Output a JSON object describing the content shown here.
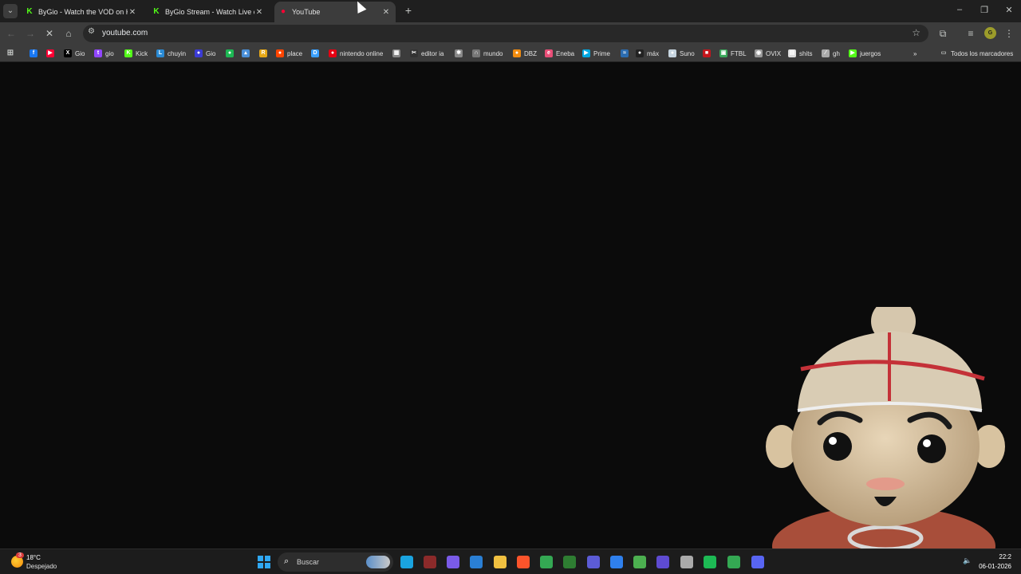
{
  "tabs": [
    {
      "title": "ByGio - Watch the VOD on Kick",
      "icon": "kick-icon",
      "color": "#53fc18"
    },
    {
      "title": "ByGio Stream - Watch Live on Kick",
      "icon": "kick-icon",
      "color": "#53fc18"
    },
    {
      "title": "YouTube",
      "icon": "youtube-icon",
      "color": "#ff0033"
    }
  ],
  "address": {
    "url": "youtube.com"
  },
  "bookmarks": [
    {
      "label": "",
      "icon": "facebook-icon",
      "color": "#1877f2"
    },
    {
      "label": "",
      "icon": "youtube-icon",
      "color": "#ff0033"
    },
    {
      "label": "Gio",
      "icon": "x-icon",
      "color": "#000000"
    },
    {
      "label": "gio",
      "icon": "twitch-icon",
      "color": "#9146ff"
    },
    {
      "label": "Kick",
      "icon": "kick-icon",
      "color": "#53fc18"
    },
    {
      "label": "chuyin",
      "icon": "letter-l-icon",
      "color": "#2a8ad4"
    },
    {
      "label": "Gio",
      "icon": "avatar-icon",
      "color": "#3b3bd4"
    },
    {
      "label": "",
      "icon": "green-circle-icon",
      "color": "#1db954"
    },
    {
      "label": "",
      "icon": "chart-icon",
      "color": "#4a90d9"
    },
    {
      "label": "",
      "icon": "r-icon",
      "color": "#e6a817"
    },
    {
      "label": "place",
      "icon": "reddit-icon",
      "color": "#ff4500"
    },
    {
      "label": "",
      "icon": "d-icon",
      "color": "#3aa0ff"
    },
    {
      "label": "nintendo online",
      "icon": "nintendo-icon",
      "color": "#e60012"
    },
    {
      "label": "",
      "icon": "grid-icon",
      "color": "#888888"
    },
    {
      "label": "editor ia",
      "icon": "capcut-icon",
      "color": "#333333"
    },
    {
      "label": "",
      "icon": "openai-icon",
      "color": "#888888"
    },
    {
      "label": "mundo",
      "icon": "headphones-icon",
      "color": "#777777"
    },
    {
      "label": "DBZ",
      "icon": "dragonball-icon",
      "color": "#f28c0f"
    },
    {
      "label": "Eneba",
      "icon": "eneba-icon",
      "color": "#e94e77"
    },
    {
      "label": "Prime",
      "icon": "prime-icon",
      "color": "#00a8e1"
    },
    {
      "label": "",
      "icon": "wave-icon",
      "color": "#2b6cb0"
    },
    {
      "label": "máx",
      "icon": "max-icon",
      "color": "#222222"
    },
    {
      "label": "Suno",
      "icon": "steam-icon",
      "color": "#c7d5e0"
    },
    {
      "label": "",
      "icon": "red-box-icon",
      "color": "#c4161c"
    },
    {
      "label": "FTBL",
      "icon": "ftbl-icon",
      "color": "#3aa65a"
    },
    {
      "label": "OVIX",
      "icon": "ovix-icon",
      "color": "#999999"
    },
    {
      "label": "shits",
      "icon": "shits-icon",
      "color": "#dddddd"
    },
    {
      "label": "gh",
      "icon": "wand-icon",
      "color": "#aaaaaa"
    },
    {
      "label": "juergos",
      "icon": "juergos-icon",
      "color": "#53fc18"
    }
  ],
  "bookmarks_folder": "Todos los marcadores",
  "weather": {
    "temp": "18°C",
    "desc": "Despejado",
    "badge": "3"
  },
  "taskbar": {
    "search_placeholder": "Buscar",
    "apps": [
      {
        "icon": "edge-icon",
        "color": "#1aa4e0"
      },
      {
        "icon": "shield-icon",
        "color": "#8b2a2a"
      },
      {
        "icon": "copilot-icon",
        "color": "#7a5be8"
      },
      {
        "icon": "store-icon",
        "color": "#2a7fd4"
      },
      {
        "icon": "folder-icon",
        "color": "#f0c040"
      },
      {
        "icon": "brave-icon",
        "color": "#fb542b"
      },
      {
        "icon": "chrome-icon",
        "color": "#34a853"
      },
      {
        "icon": "minecraft-launcher-icon",
        "color": "#2e7d32"
      },
      {
        "icon": "fire-icon",
        "color": "#5c5cd6"
      },
      {
        "icon": "vscode-icon",
        "color": "#2f80ed"
      },
      {
        "icon": "minecraft-icon",
        "color": "#4caf50"
      },
      {
        "icon": "app-icon",
        "color": "#5e4bd1"
      },
      {
        "icon": "github-icon",
        "color": "#aaaaaa"
      },
      {
        "icon": "spotify-icon",
        "color": "#1db954"
      },
      {
        "icon": "chrome-profile-icon",
        "color": "#34a853"
      },
      {
        "icon": "discord-icon",
        "color": "#5865f2"
      }
    ],
    "time": "22:2",
    "date": "06-01-2026"
  }
}
